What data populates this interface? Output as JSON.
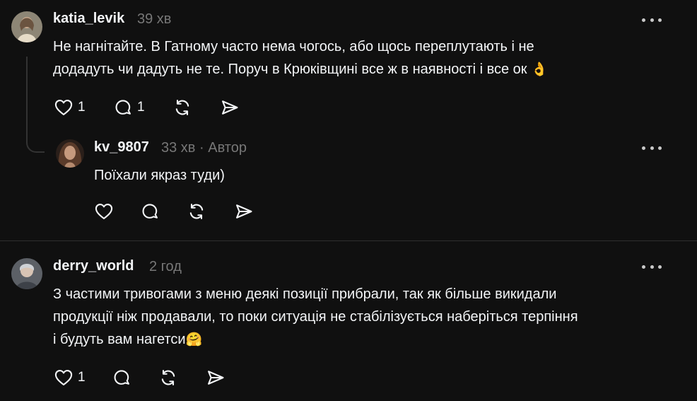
{
  "comments": [
    {
      "username": "katia_levik",
      "time": "39 хв",
      "lines": [
        "Не нагнітайте. В Гатному часто нема чогось, або щось переплутають і не",
        "додадуть чи дадуть не те. Поруч в Крюківщині все ж в наявності і все ок"
      ],
      "emoji": "👌",
      "likes": "1",
      "replies": "1"
    },
    {
      "username": "kv_9807",
      "time": "33 хв",
      "separator": "·",
      "author_badge": "Автор",
      "lines": [
        "Поїхали якраз туди)"
      ]
    },
    {
      "username": "derry_world",
      "time": "2 год",
      "lines": [
        "З частими тривогами з меню деякі позиції прибрали, так як більше викидали",
        "продукції ніж продавали, то поки ситуація не стабілізується наберіться терпіння",
        "і будуть вам нагетси"
      ],
      "emoji": "🤗",
      "likes": "1"
    }
  ],
  "colors": {
    "background": "#101010",
    "text": "#f3f5f7",
    "muted": "#777777",
    "divider": "#2e2e2e"
  },
  "icons": [
    "heart-icon",
    "comment-icon",
    "repost-icon",
    "share-icon",
    "more-icon"
  ]
}
